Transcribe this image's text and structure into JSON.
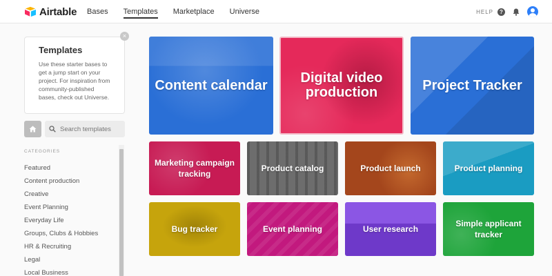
{
  "app": {
    "name": "Airtable",
    "brand_colors": [
      "#fcb400",
      "#18bfff",
      "#f82b60"
    ]
  },
  "nav": {
    "items": [
      {
        "label": "Bases"
      },
      {
        "label": "Templates",
        "active": true
      },
      {
        "label": "Marketplace"
      },
      {
        "label": "Universe"
      }
    ],
    "help_label": "HELP",
    "help_icon": "?"
  },
  "sidebar": {
    "info_card": {
      "title": "Templates",
      "text": "Use these starter bases to get a jump start on your project. For inspiration from community-published bases, check out Universe.",
      "close_icon": "×"
    },
    "search": {
      "placeholder": "Search templates",
      "value": ""
    },
    "categories_header": "CATEGORIES",
    "categories": [
      {
        "label": "Featured"
      },
      {
        "label": "Content production"
      },
      {
        "label": "Creative"
      },
      {
        "label": "Event Planning"
      },
      {
        "label": "Everyday Life"
      },
      {
        "label": "Groups, Clubs & Hobbies"
      },
      {
        "label": "HR & Recruiting"
      },
      {
        "label": "Legal"
      },
      {
        "label": "Local Business"
      }
    ]
  },
  "templates": {
    "featured": [
      {
        "label": "Content calendar",
        "color": "#2a6fd6"
      },
      {
        "label": "Digital video production",
        "color": "#e5295a"
      },
      {
        "label": "Project Tracker",
        "color": "#2a6fd6"
      }
    ],
    "row2": [
      {
        "label": "Marketing campaign tracking",
        "color": "#c71b54"
      },
      {
        "label": "Product catalog",
        "color": "#6d6d6d"
      },
      {
        "label": "Product launch",
        "color": "#a4461c"
      },
      {
        "label": "Product planning",
        "color": "#1a9cc2"
      }
    ],
    "row3": [
      {
        "label": "Bug tracker",
        "color": "#c6a40c"
      },
      {
        "label": "Event planning",
        "color": "#c2197e"
      },
      {
        "label": "User research",
        "color": "#7b3fe0"
      },
      {
        "label": "Simple applicant tracker",
        "color": "#1ea43a"
      }
    ]
  }
}
